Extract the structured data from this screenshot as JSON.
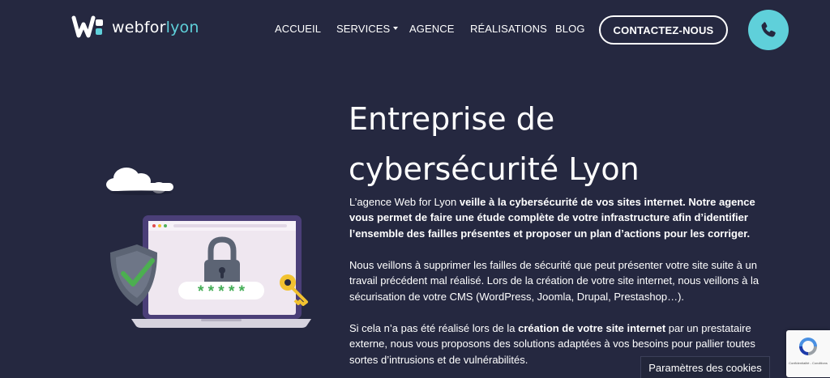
{
  "header": {
    "logo": {
      "text_main": "webfor",
      "text_accent": "lyon"
    },
    "nav": [
      {
        "label": "ACCUEIL",
        "has_dropdown": false
      },
      {
        "label": "SERVICES",
        "has_dropdown": true
      },
      {
        "label": "AGENCE",
        "has_dropdown": false
      },
      {
        "label": "RÉALISATIONS",
        "has_dropdown": false
      },
      {
        "label": "BLOG",
        "has_dropdown": false
      }
    ],
    "cta_label": "CONTACTEZ-NOUS",
    "phone_icon": "phone-icon"
  },
  "hero": {
    "title_line1": "Entreprise de",
    "title_line2": "cybersécurité Lyon",
    "p1": {
      "part1": "L’agence Web for Lyon ",
      "part2_bold": "veille à la cybersécurité de vos sites internet. Notre agence vous permet de faire une étude complète de votre infrastructure afin d’identifier l’ensemble des failles présentes et proposer un plan d’actions pour les corriger."
    },
    "p2": "Nous veillons à supprimer les failles de sécurité que peut présenter votre site suite à un travail précédent mal réalisé. Lors de la création de votre site internet, nous veillons à la sécurisation de votre CMS (WordPress, Joomla, Drupal, Prestashop…).",
    "p3": {
      "part1": "Si cela n’a pas été réalisé lors de la ",
      "part2_bold": "création de votre site internet",
      "part3": " par un prestataire externe, nous vous proposons des solutions adaptées à vos besoins pour pallier toutes sortes d’intrusions et de vulnérabilités."
    },
    "illustration": {
      "password_mask": "* * * * *",
      "icons": [
        "cloud-icon",
        "shield-check-icon",
        "padlock-icon",
        "key-icon",
        "laptop-icon"
      ]
    }
  },
  "footer_widgets": {
    "cookie_label": "Paramètres des cookies",
    "recaptcha_text": "Confidentialité - Conditions"
  },
  "colors": {
    "background": "#252840",
    "accent": "#5fd0da",
    "shield": "#5c6474",
    "check": "#4caf50",
    "key": "#f2c230"
  }
}
